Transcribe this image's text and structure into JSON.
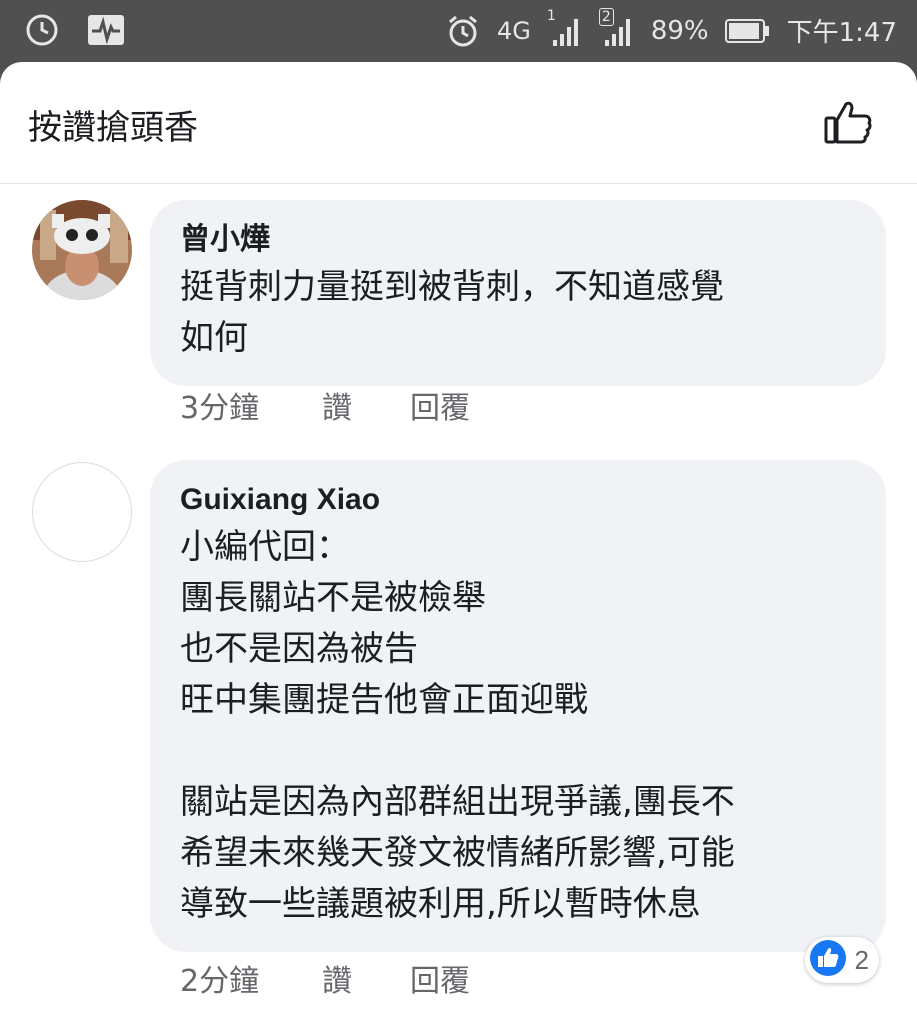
{
  "status_bar": {
    "network": "4G",
    "sim1": "1",
    "sim2": "2",
    "battery": "89%",
    "time": "下午1:47"
  },
  "sheet": {
    "title": "按讚搶頭香",
    "header_icon": "thumbs-up-outline-icon"
  },
  "comments": [
    {
      "author": "曾小燁",
      "text": "挺背刺力量挺到被背刺，不知道感覺\n如何",
      "time": "3分鐘",
      "like_label": "讚",
      "reply_label": "回覆"
    },
    {
      "author": "Guixiang Xiao",
      "text": "小編代回：\n團長關站不是被檢舉\n也不是因為被告\n旺中集團提告他會正面迎戰\n\n關站是因為內部群組出現爭議,團長不\n希望未來幾天發文被情緒所影響,可能\n導致一些議題被利用,所以暫時休息",
      "time": "2分鐘",
      "like_label": "讚",
      "reply_label": "回覆",
      "reaction_count": "2"
    }
  ],
  "colors": {
    "accent": "#1877f2",
    "bubble": "#f0f2f5",
    "secondary_text": "#65676b"
  }
}
